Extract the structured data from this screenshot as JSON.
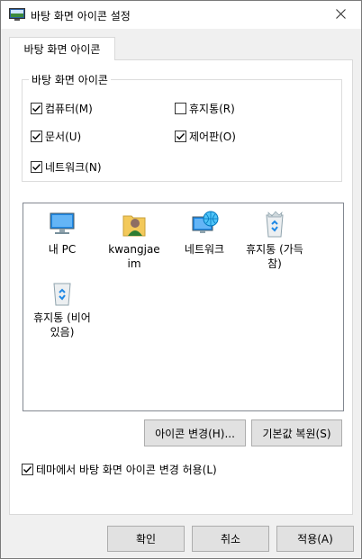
{
  "window": {
    "title": "바탕 화면 아이콘 설정"
  },
  "tab": {
    "label": "바탕 화면 아이콘"
  },
  "group": {
    "legend": "바탕 화면 아이콘",
    "checkboxes": {
      "computer": {
        "label": "컴퓨터(M)",
        "checked": true
      },
      "recycle": {
        "label": "휴지통(R)",
        "checked": false
      },
      "documents": {
        "label": "문서(U)",
        "checked": true
      },
      "control": {
        "label": "제어판(O)",
        "checked": true
      },
      "network": {
        "label": "네트워크(N)",
        "checked": true
      }
    }
  },
  "icons": {
    "mypc": "내 PC",
    "user_line1": "kwangjae",
    "user_line2": "im",
    "network": "네트워크",
    "recycle_full_line1": "휴지통 (가득",
    "recycle_full_line2": "참)",
    "recycle_empty_line1": "휴지통 (비어",
    "recycle_empty_line2": "있음)"
  },
  "buttons": {
    "change_icon": "아이콘 변경(H)...",
    "restore_default": "기본값 복원(S)",
    "ok": "확인",
    "cancel": "취소",
    "apply": "적용(A)"
  },
  "theme_checkbox": {
    "label": "테마에서 바탕 화면 아이콘 변경 허용(L)",
    "checked": true
  }
}
